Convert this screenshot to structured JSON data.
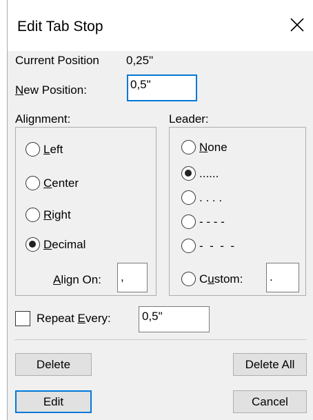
{
  "dialog": {
    "title": "Edit Tab Stop",
    "close_glyph": "×"
  },
  "current_position": {
    "label": "Current Position",
    "value": "0,25\""
  },
  "new_position": {
    "label_pre": "",
    "label_mnemonic": "N",
    "label_post": "ew Position:",
    "value": "0,5\""
  },
  "alignment": {
    "label": "Alignment:",
    "options": [
      {
        "mnemonic": "L",
        "rest": "eft",
        "checked": false
      },
      {
        "mnemonic": "C",
        "rest": "enter",
        "checked": false
      },
      {
        "mnemonic": "R",
        "rest": "ight",
        "checked": false
      },
      {
        "mnemonic": "D",
        "rest": "ecimal",
        "checked": true
      }
    ],
    "align_on": {
      "mnemonic": "A",
      "rest": "lign On:",
      "value": ","
    }
  },
  "leader": {
    "label": "Leader:",
    "options": [
      {
        "label_mnemonic": "N",
        "label_rest": "one",
        "checked": false
      },
      {
        "label": "......",
        "checked": true
      },
      {
        "label": ". . . .",
        "checked": false
      },
      {
        "label": "- - - -",
        "checked": false
      },
      {
        "label": "-  -  -  -",
        "checked": false
      }
    ],
    "custom": {
      "pre": "C",
      "mnemonic": "u",
      "post": "stom:",
      "value": ".",
      "checked": false
    }
  },
  "repeat_every": {
    "pre": "Repeat ",
    "mnemonic": "E",
    "post": "very:",
    "value": "0,5\"",
    "checked": false
  },
  "buttons": {
    "delete": "Delete",
    "delete_all": "Delete All",
    "edit": "Edit",
    "cancel": "Cancel"
  }
}
